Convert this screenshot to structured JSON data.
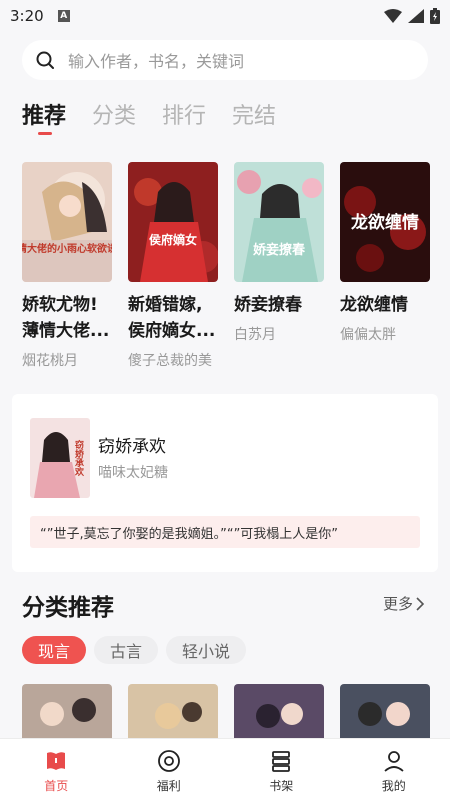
{
  "status": {
    "time": "3:20",
    "indicator": "A"
  },
  "search": {
    "placeholder": "输入作者，书名，关键词"
  },
  "tabs": [
    {
      "label": "推荐",
      "active": true
    },
    {
      "label": "分类"
    },
    {
      "label": "排行"
    },
    {
      "label": "完结"
    }
  ],
  "books": [
    {
      "title_line1": "娇软尤物!",
      "title_line2": "薄情大佬...",
      "author": "烟花桃月",
      "cover_text": "薄情大佬的小雨心软欲诱人"
    },
    {
      "title_line1": "新婚错嫁,",
      "title_line2": "侯府嫡女...",
      "author": "傻子总裁的美",
      "cover_text": "侯府嫡女"
    },
    {
      "title_line1": "娇妾撩春",
      "title_line2": "",
      "author": "白苏月",
      "cover_text": "娇妾撩春"
    },
    {
      "title_line1": "龙欲缠情",
      "title_line2": "",
      "author": "偏偏太胖",
      "cover_text": "龙欲缠情"
    }
  ],
  "feature": {
    "title": "窃娇承欢",
    "author": "喵味太妃糖",
    "quote": "“”世子,莫忘了你娶的是我嫡姐。”“”可我榻上人是你”",
    "cover_text": "窃娇承欢"
  },
  "section": {
    "title": "分类推荐",
    "more": "更多"
  },
  "chips": [
    {
      "label": "现言",
      "active": true
    },
    {
      "label": "古言"
    },
    {
      "label": "轻小说"
    }
  ],
  "nav": [
    {
      "label": "首页",
      "active": true
    },
    {
      "label": "福利"
    },
    {
      "label": "书架"
    },
    {
      "label": "我的"
    }
  ],
  "colors": {
    "accent": "#e84b4b",
    "chip_active": "#ef5350",
    "quote_bg": "#fdeeed"
  }
}
